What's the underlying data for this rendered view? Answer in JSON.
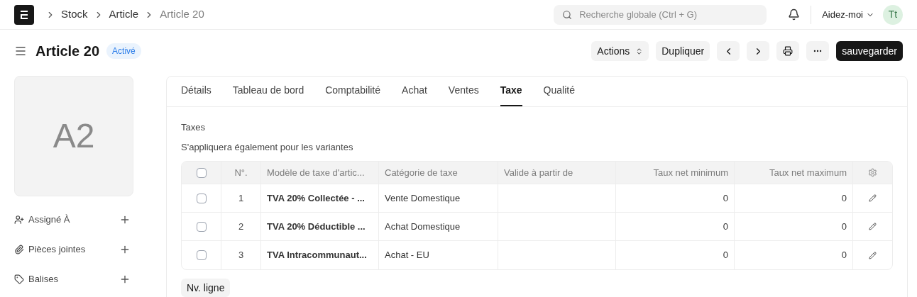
{
  "breadcrumbs": [
    "Stock",
    "Article",
    "Article 20"
  ],
  "search": {
    "placeholder": "Recherche globale (Ctrl + G)"
  },
  "help_menu": "Aidez-moi",
  "avatar": "Tt",
  "title": "Article 20",
  "status": "Activé",
  "actions": {
    "menu": "Actions",
    "duplicate": "Dupliquer",
    "save": "sauvegarder"
  },
  "image_placeholder": "A2",
  "sidebar": [
    {
      "kind": "assign",
      "label": "Assigné À"
    },
    {
      "kind": "attach",
      "label": "Pièces jointes"
    },
    {
      "kind": "tag",
      "label": "Balises"
    }
  ],
  "tabs": [
    {
      "label": "Détails",
      "selected": false
    },
    {
      "label": "Tableau de bord",
      "selected": false
    },
    {
      "label": "Comptabilité",
      "selected": false
    },
    {
      "label": "Achat",
      "selected": false
    },
    {
      "label": "Ventes",
      "selected": false
    },
    {
      "label": "Taxe",
      "selected": true
    },
    {
      "label": "Qualité",
      "selected": false
    }
  ],
  "section_title": "Taxes",
  "section_note": "S'appliquera également pour les variantes",
  "table": {
    "header_checked": false,
    "columns": [
      "N°.",
      "Modèle de taxe d'artic...",
      "Catégorie de taxe",
      "Valide à partir de",
      "Taux net minimum",
      "Taux net maximum"
    ],
    "rows": [
      {
        "checked": false,
        "no": "1",
        "template": "TVA 20% Collectée - ...",
        "category": "Vente Domestique",
        "min": "0",
        "max": "0"
      },
      {
        "checked": false,
        "no": "2",
        "template": "TVA 20% Déductible ...",
        "category": "Achat Domestique",
        "min": "0",
        "max": "0"
      },
      {
        "checked": false,
        "no": "3",
        "template": "TVA Intracommunaut...",
        "category": "Achat - EU",
        "min": "0",
        "max": "0"
      }
    ]
  },
  "add_row": "Nv. ligne"
}
